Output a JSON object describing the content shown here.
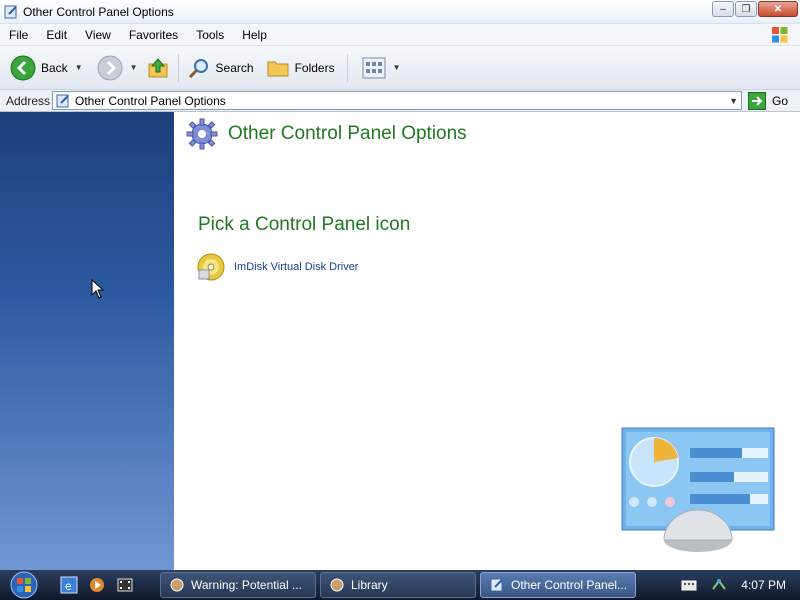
{
  "window": {
    "title": "Other Control Panel Options",
    "controls": {
      "minimize": "–",
      "maximize": "❐",
      "close": "✕"
    }
  },
  "menu": {
    "items": [
      "File",
      "Edit",
      "View",
      "Favorites",
      "Tools",
      "Help"
    ]
  },
  "toolbar": {
    "back_label": "Back",
    "search_label": "Search",
    "folders_label": "Folders"
  },
  "address": {
    "label": "Address",
    "value": "Other Control Panel Options",
    "go_label": "Go"
  },
  "main": {
    "page_title": "Other Control Panel Options",
    "section_title": "Pick a Control Panel icon",
    "items": [
      {
        "label": "ImDisk Virtual Disk Driver",
        "icon": "disk-icon"
      }
    ]
  },
  "taskbar": {
    "tasks": [
      {
        "label": "Warning: Potential ...",
        "icon": "security-icon",
        "active": false
      },
      {
        "label": "Library",
        "icon": "library-icon",
        "active": false
      },
      {
        "label": "Other Control Panel...",
        "icon": "control-panel-icon",
        "active": true
      }
    ],
    "clock": "4:07 PM"
  },
  "colors": {
    "accent_green": "#1f7a1f",
    "link_blue": "#15428b",
    "left_pane_top": "#1e3f7c"
  }
}
